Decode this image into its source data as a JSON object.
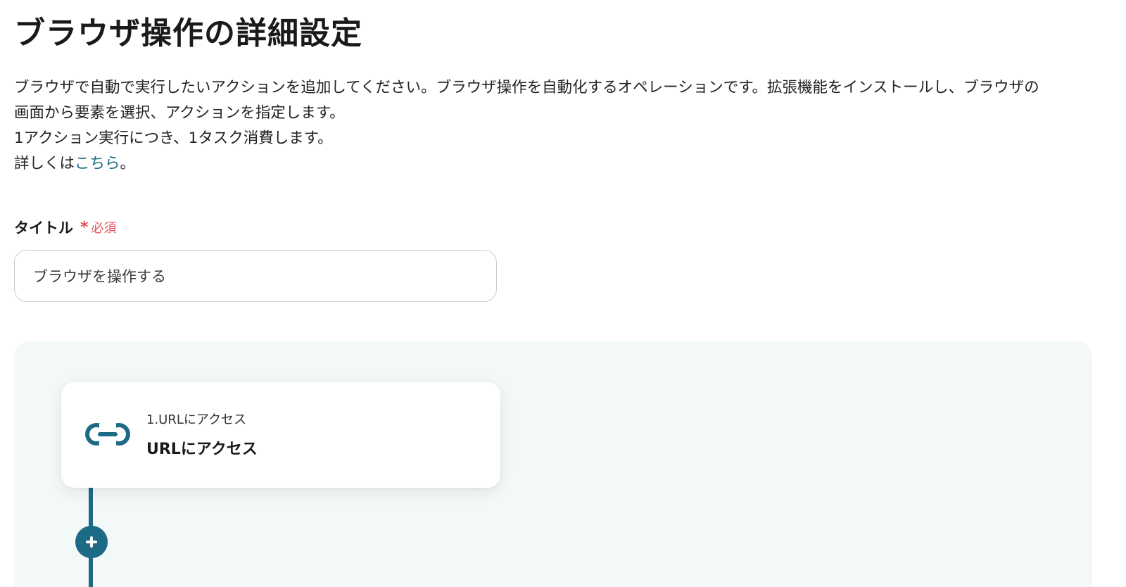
{
  "header": {
    "title": "ブラウザ操作の詳細設定"
  },
  "description": {
    "line1": "ブラウザで自動で実行したいアクションを追加してください。ブラウザ操作を自動化するオペレーションです。拡張機能をインストールし、ブラウザの",
    "line2": "画面から要素を選択、アクションを指定します。",
    "line3": "1アクション実行につき、1タスク消費します。",
    "line4_prefix": "詳しくは",
    "line4_link": "こちら",
    "line4_suffix": "。"
  },
  "title_field": {
    "label": "タイトル",
    "required_mark": "*",
    "required_text": "必須",
    "value": "ブラウザを操作する"
  },
  "actions": [
    {
      "icon": "link-icon",
      "subtitle": "1.URLにアクセス",
      "title": "URLにアクセス"
    }
  ],
  "add_button": {
    "icon": "plus-icon"
  },
  "colors": {
    "accent": "#1d6a86",
    "required": "#e8505b",
    "canvas_bg": "#f2f9f8"
  }
}
